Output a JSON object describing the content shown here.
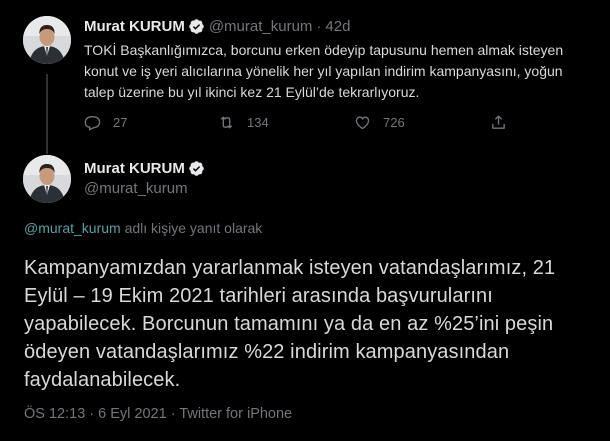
{
  "colors": {
    "background": "#000000",
    "text": "#d9d9d9",
    "muted": "#71767b",
    "verified": "#e7e9ea",
    "mention": "#5aa0a0",
    "thread_line": "#2f3336"
  },
  "parent_tweet": {
    "display_name": "Murat KURUM",
    "handle": "@murat_kurum",
    "separator": "·",
    "time": "42d",
    "text": "TOKİ Başkanlığımızca, borcunu erken ödeyip tapusunu hemen almak isteyen konut ve iş yeri alıcılarına yönelik her yıl yapılan indirim kampanyasını, yoğun talep üzerine bu yıl ikinci kez 21 Eylül’de tekrarlıyoruz.",
    "actions": {
      "reply_icon": "reply-icon",
      "reply_count": "27",
      "retweet_icon": "retweet-icon",
      "retweet_count": "134",
      "like_icon": "heart-icon",
      "like_count": "726",
      "share_icon": "share-icon"
    }
  },
  "main_tweet": {
    "display_name": "Murat KURUM",
    "handle": "@murat_kurum",
    "reply_to_mention": "@murat_kurum",
    "reply_to_suffix": " adlı kişiye yanıt olarak",
    "text": "Kampanyamızdan yararlanmak isteyen vatandaşlarımız, 21 Eylül – 19 Ekim 2021 tarihleri arasında başvurularını yapabilecek. Borcunun tamamını ya da en az %25’ini peşin ödeyen vatandaşlarımız %22  indirim kampanyasından faydalanabilecek.",
    "timestamp": "ÖS 12:13 · 6 Eyl 2021 · Twitter for iPhone"
  }
}
